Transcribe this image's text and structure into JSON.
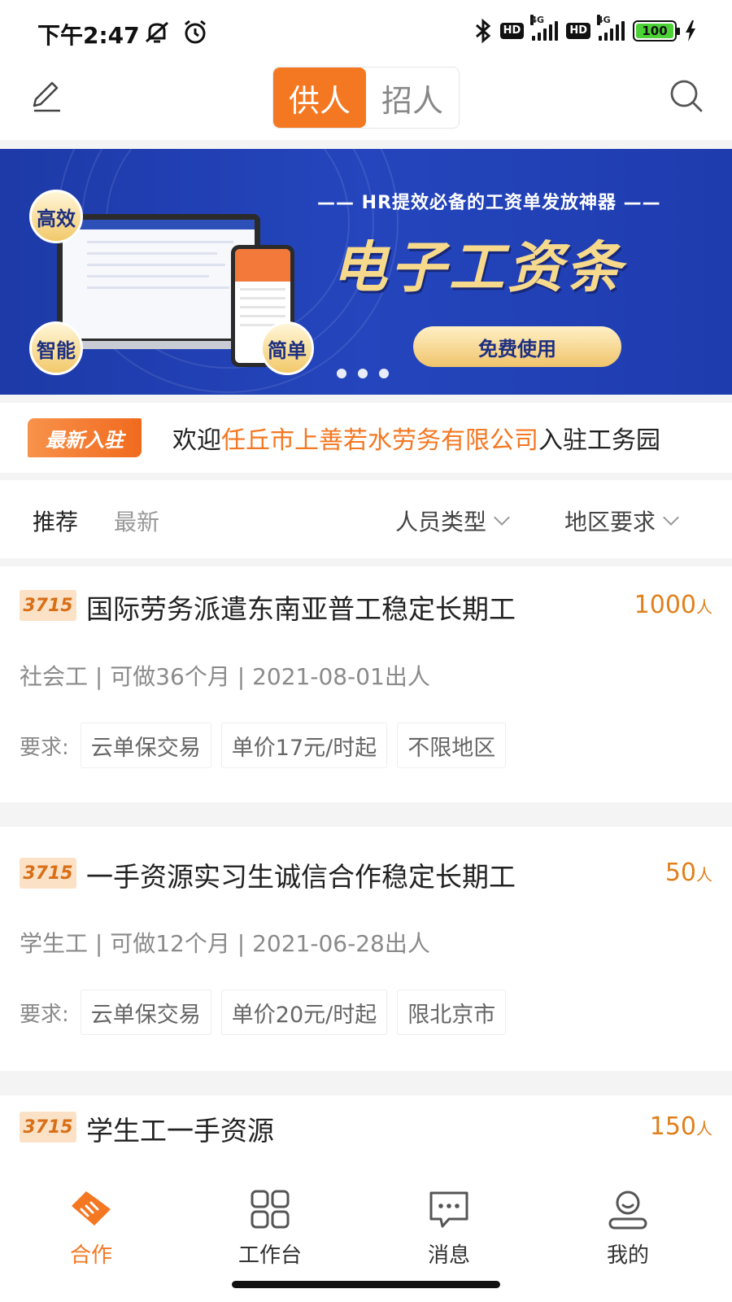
{
  "status_bar": {
    "time": "下午2:47",
    "hd1": "HD",
    "hd2": "HD",
    "net1": "4G",
    "net2": "4G",
    "battery": "100"
  },
  "header": {
    "tabs": [
      {
        "label": "供人",
        "active": true
      },
      {
        "label": "招人",
        "active": false
      }
    ]
  },
  "banner": {
    "subtitle": "—— HR提效必备的工资单发放神器 ——",
    "title": "电子工资条",
    "cta": "免费使用",
    "badges": [
      "高效",
      "智能",
      "简单"
    ],
    "dots": 3,
    "bg_color": "#2445bd"
  },
  "notice": {
    "badge": "最新入驻",
    "prefix": "欢迎",
    "company": "任丘市上善若水劳务有限公司",
    "suffix": "入驻工务园"
  },
  "filter": {
    "tab_recommended": "推荐",
    "tab_latest": "最新",
    "dropdown_type": "人员类型",
    "dropdown_region": "地区要求"
  },
  "cards": [
    {
      "tag": "3715",
      "title": "国际劳务派遣东南亚普工稳定长期工",
      "count": "1000",
      "unit": "人",
      "meta": "社会工 | 可做36个月 | 2021-08-01出人",
      "req_label": "要求:",
      "chips": [
        "云单保交易",
        "单价17元/时起",
        "不限地区"
      ]
    },
    {
      "tag": "3715",
      "title": "一手资源实习生诚信合作稳定长期工",
      "count": "50",
      "unit": "人",
      "meta": "学生工 | 可做12个月 | 2021-06-28出人",
      "req_label": "要求:",
      "chips": [
        "云单保交易",
        "单价20元/时起",
        "限北京市"
      ]
    },
    {
      "tag": "3715",
      "title": "学生工一手资源",
      "count": "150",
      "unit": "人"
    }
  ],
  "bottom_nav": [
    {
      "label": "合作",
      "icon": "handshake-icon",
      "active": true
    },
    {
      "label": "工作台",
      "icon": "grid-icon",
      "active": false
    },
    {
      "label": "消息",
      "icon": "message-icon",
      "active": false
    },
    {
      "label": "我的",
      "icon": "profile-icon",
      "active": false
    }
  ],
  "accent_color": "#f47722"
}
